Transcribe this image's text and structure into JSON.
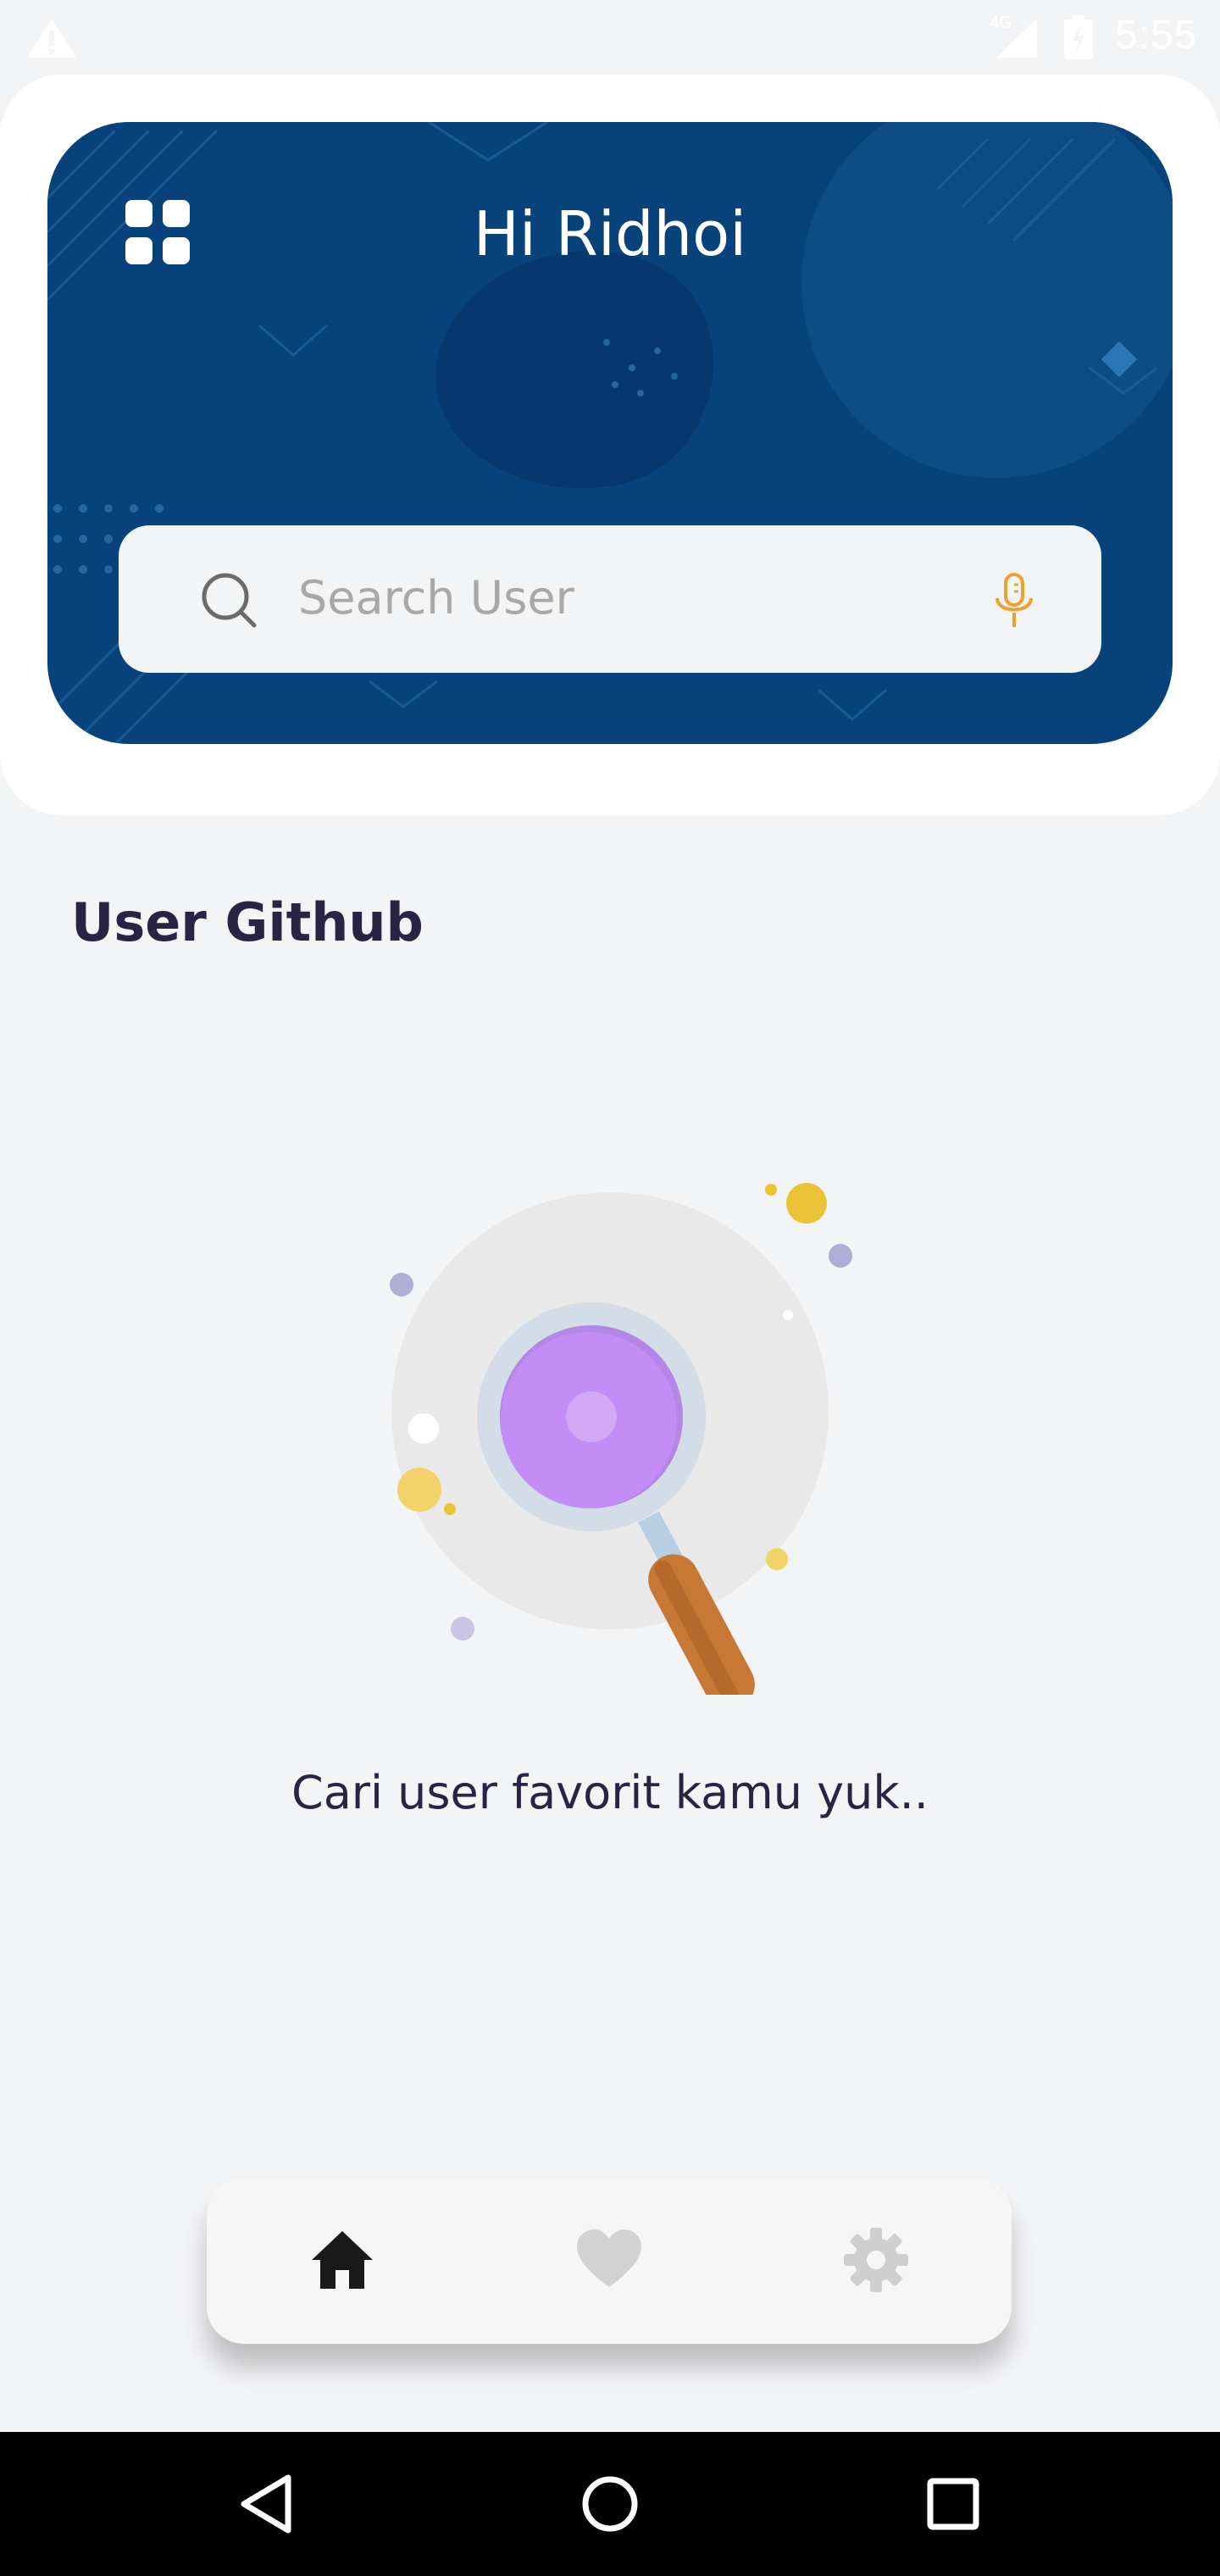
{
  "status_bar": {
    "time": "5:55",
    "network_label": "4G",
    "icons": [
      "warning-icon",
      "signal-icon",
      "battery-icon"
    ]
  },
  "header": {
    "greeting": "Hi Ridhoi",
    "menu_icon": "grid-menu-icon",
    "background_color": "#08427A"
  },
  "search": {
    "placeholder": "Search User",
    "value": "",
    "left_icon": "search-icon",
    "right_icon": "microphone-icon",
    "mic_color": "#F0A030"
  },
  "main": {
    "section_title": "User Github",
    "empty_state_text": "Cari user favorit kamu yuk..",
    "illustration": "magnifier-illustration"
  },
  "bottom_nav": {
    "items": [
      {
        "icon": "home-icon",
        "active": true
      },
      {
        "icon": "heart-icon",
        "active": false
      },
      {
        "icon": "settings-icon",
        "active": false
      }
    ],
    "active_color": "#1A1A1A",
    "inactive_color": "#CFCFCF"
  },
  "system_nav": {
    "buttons": [
      "back-icon",
      "home-circle-icon",
      "recents-icon"
    ]
  }
}
